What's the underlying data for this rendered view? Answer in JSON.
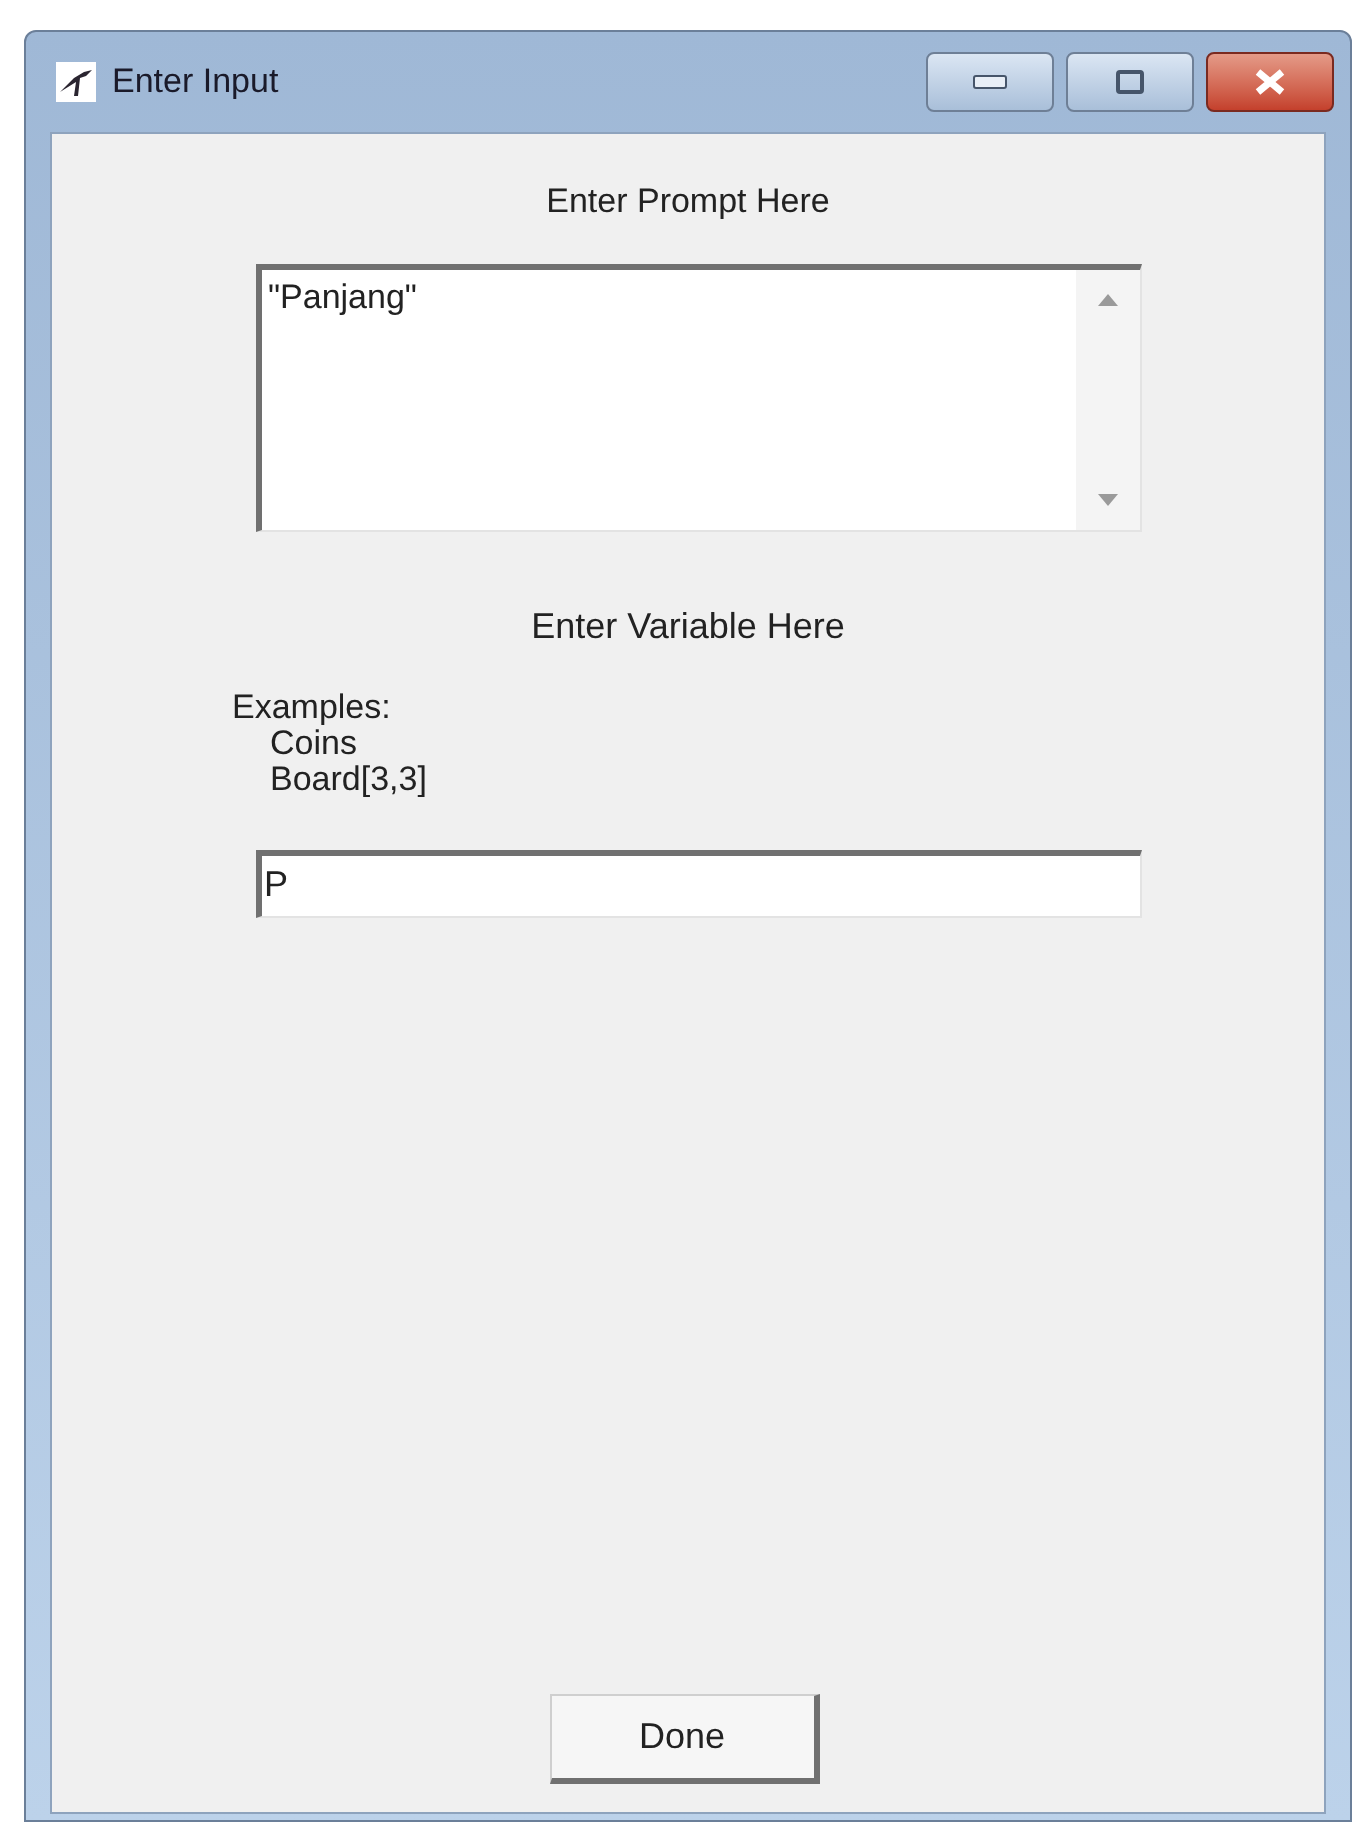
{
  "window": {
    "title": "Enter Input"
  },
  "prompt": {
    "label": "Enter Prompt Here",
    "value": "\"Panjang\""
  },
  "variable": {
    "label": "Enter Variable Here",
    "examples_label": "Examples:",
    "examples": [
      "Coins",
      "Board[3,3]"
    ],
    "value": "P"
  },
  "buttons": [
    {
      "label": "Done"
    }
  ]
}
